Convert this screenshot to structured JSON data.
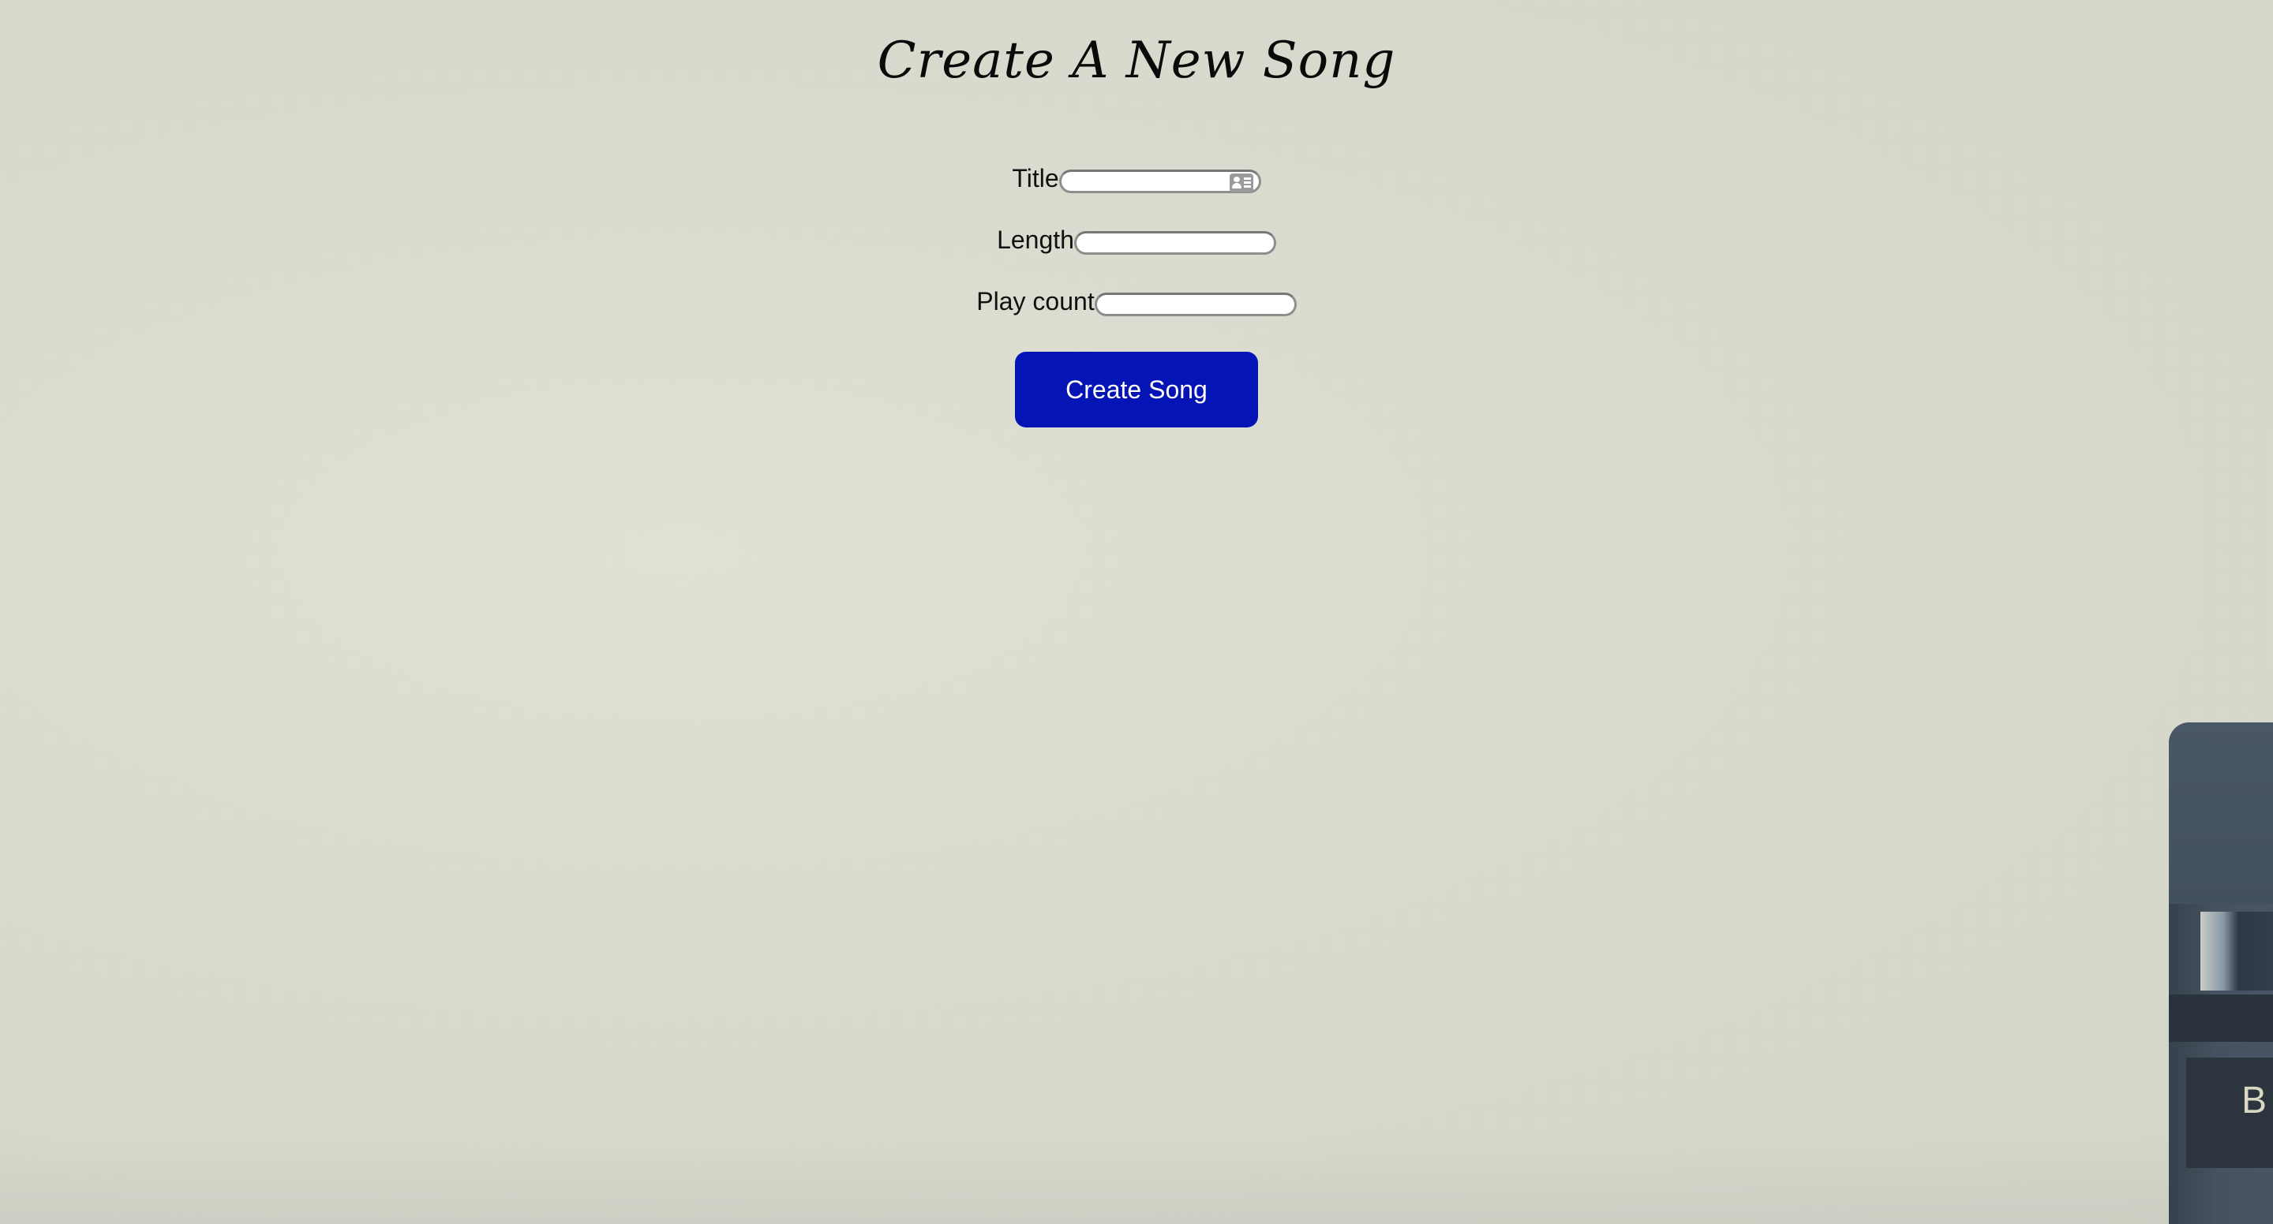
{
  "page": {
    "title": "Create A New Song"
  },
  "form": {
    "fields": [
      {
        "label": "Title",
        "value": "",
        "placeholder": ""
      },
      {
        "label": "Length",
        "value": "",
        "placeholder": ""
      },
      {
        "label": "Play count",
        "value": "",
        "placeholder": ""
      }
    ],
    "submit_label": "Create Song"
  },
  "icons": {
    "title_autofill": "contact-card-icon"
  },
  "background": {
    "edge_object_letter": "B"
  },
  "colors": {
    "button": "#0514b4",
    "button_text": "#ffffff",
    "background": "#d8dbcd"
  }
}
